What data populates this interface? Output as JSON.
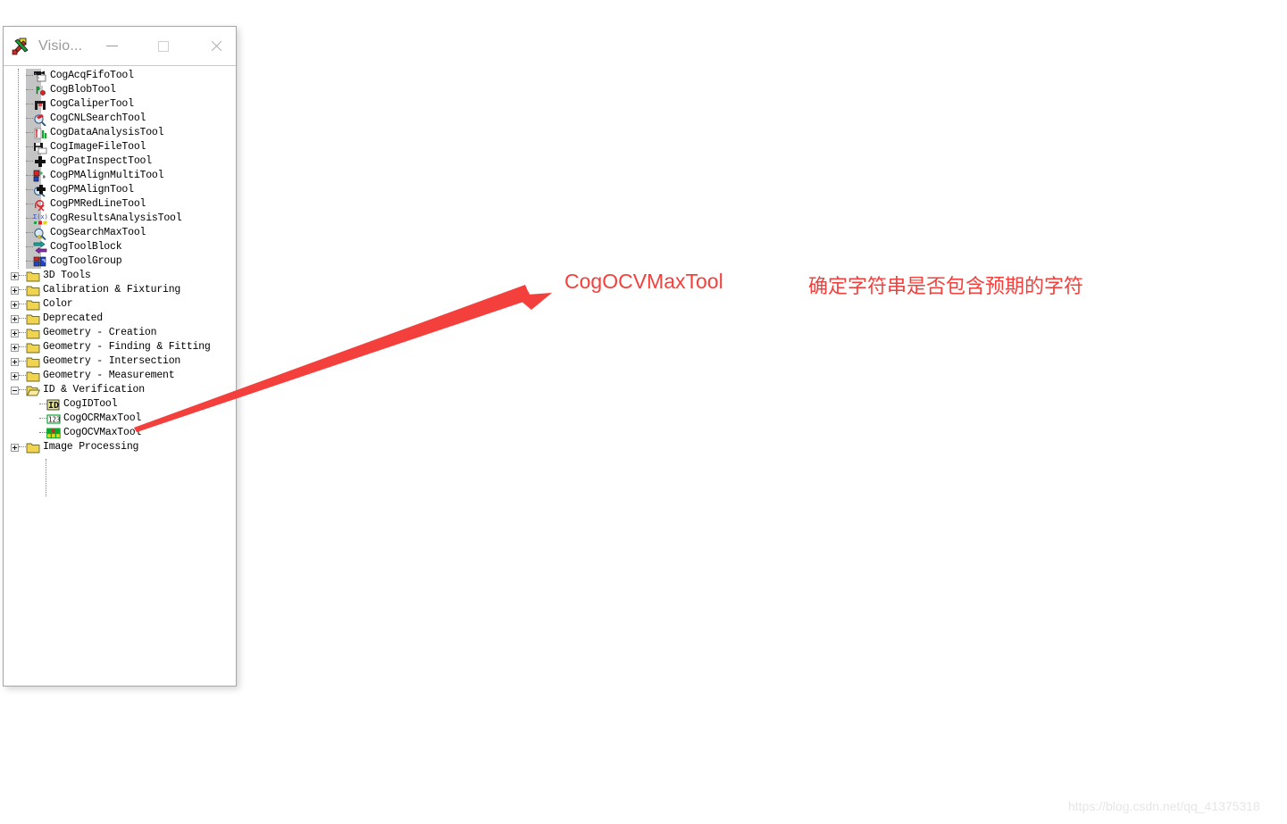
{
  "window": {
    "title": "Visio...",
    "icon": "tools-icon",
    "controls": {
      "minimize": "minimize-icon",
      "maximize": "maximize-icon",
      "close": "close-icon"
    }
  },
  "tree": {
    "items": [
      {
        "label": "CogAcqFifoTool",
        "level": 1,
        "kind": "tool",
        "icon": "acq-fifo-tool-icon"
      },
      {
        "label": "CogBlobTool",
        "level": 1,
        "kind": "tool",
        "icon": "blob-tool-icon"
      },
      {
        "label": "CogCaliperTool",
        "level": 1,
        "kind": "tool",
        "icon": "caliper-tool-icon"
      },
      {
        "label": "CogCNLSearchTool",
        "level": 1,
        "kind": "tool",
        "icon": "cnl-search-tool-icon"
      },
      {
        "label": "CogDataAnalysisTool",
        "level": 1,
        "kind": "tool",
        "icon": "data-analysis-tool-icon"
      },
      {
        "label": "CogImageFileTool",
        "level": 1,
        "kind": "tool",
        "icon": "image-file-tool-icon"
      },
      {
        "label": "CogPatInspectTool",
        "level": 1,
        "kind": "tool",
        "icon": "pat-inspect-tool-icon"
      },
      {
        "label": "CogPMAlignMultiTool",
        "level": 1,
        "kind": "tool",
        "icon": "pmalign-multi-tool-icon"
      },
      {
        "label": "CogPMAlignTool",
        "level": 1,
        "kind": "tool",
        "icon": "pmalign-tool-icon"
      },
      {
        "label": "CogPMRedLineTool",
        "level": 1,
        "kind": "tool",
        "icon": "pmredline-tool-icon"
      },
      {
        "label": "CogResultsAnalysisTool",
        "level": 1,
        "kind": "tool",
        "icon": "results-analysis-tool-icon"
      },
      {
        "label": "CogSearchMaxTool",
        "level": 1,
        "kind": "tool",
        "icon": "search-max-tool-icon"
      },
      {
        "label": "CogToolBlock",
        "level": 1,
        "kind": "tool",
        "icon": "tool-block-icon"
      },
      {
        "label": "CogToolGroup",
        "level": 1,
        "kind": "tool",
        "icon": "tool-group-icon"
      },
      {
        "label": "3D Tools",
        "level": 0,
        "kind": "folder",
        "icon": "folder-icon",
        "state": "collapsed"
      },
      {
        "label": "Calibration & Fixturing",
        "level": 0,
        "kind": "folder",
        "icon": "folder-icon",
        "state": "collapsed"
      },
      {
        "label": "Color",
        "level": 0,
        "kind": "folder",
        "icon": "folder-icon",
        "state": "collapsed"
      },
      {
        "label": "Deprecated",
        "level": 0,
        "kind": "folder",
        "icon": "folder-icon",
        "state": "collapsed"
      },
      {
        "label": "Geometry - Creation",
        "level": 0,
        "kind": "folder",
        "icon": "folder-icon",
        "state": "collapsed"
      },
      {
        "label": "Geometry - Finding & Fitting",
        "level": 0,
        "kind": "folder",
        "icon": "folder-icon",
        "state": "collapsed"
      },
      {
        "label": "Geometry - Intersection",
        "level": 0,
        "kind": "folder",
        "icon": "folder-icon",
        "state": "collapsed"
      },
      {
        "label": "Geometry - Measurement",
        "level": 0,
        "kind": "folder",
        "icon": "folder-icon",
        "state": "collapsed"
      },
      {
        "label": "ID & Verification",
        "level": 0,
        "kind": "folder",
        "icon": "folder-open-icon",
        "state": "expanded"
      },
      {
        "label": "CogIDTool",
        "level": 2,
        "kind": "tool",
        "icon": "id-tool-icon"
      },
      {
        "label": "CogOCRMaxTool",
        "level": 2,
        "kind": "tool",
        "icon": "ocrmax-tool-icon"
      },
      {
        "label": "CogOCVMaxTool",
        "level": 2,
        "kind": "tool",
        "icon": "ocvmax-tool-icon"
      },
      {
        "label": "Image Processing",
        "level": 0,
        "kind": "folder",
        "icon": "folder-icon",
        "state": "collapsed"
      }
    ]
  },
  "annotation": {
    "title": "CogOCVMaxTool",
    "description": "确定字符串是否包含预期的字符",
    "color": "#f4403c",
    "arrow": "red-arrow-pointer"
  },
  "watermark": {
    "text": "https://blog.csdn.net/qq_41375318",
    "color": "#e6e6e6"
  }
}
